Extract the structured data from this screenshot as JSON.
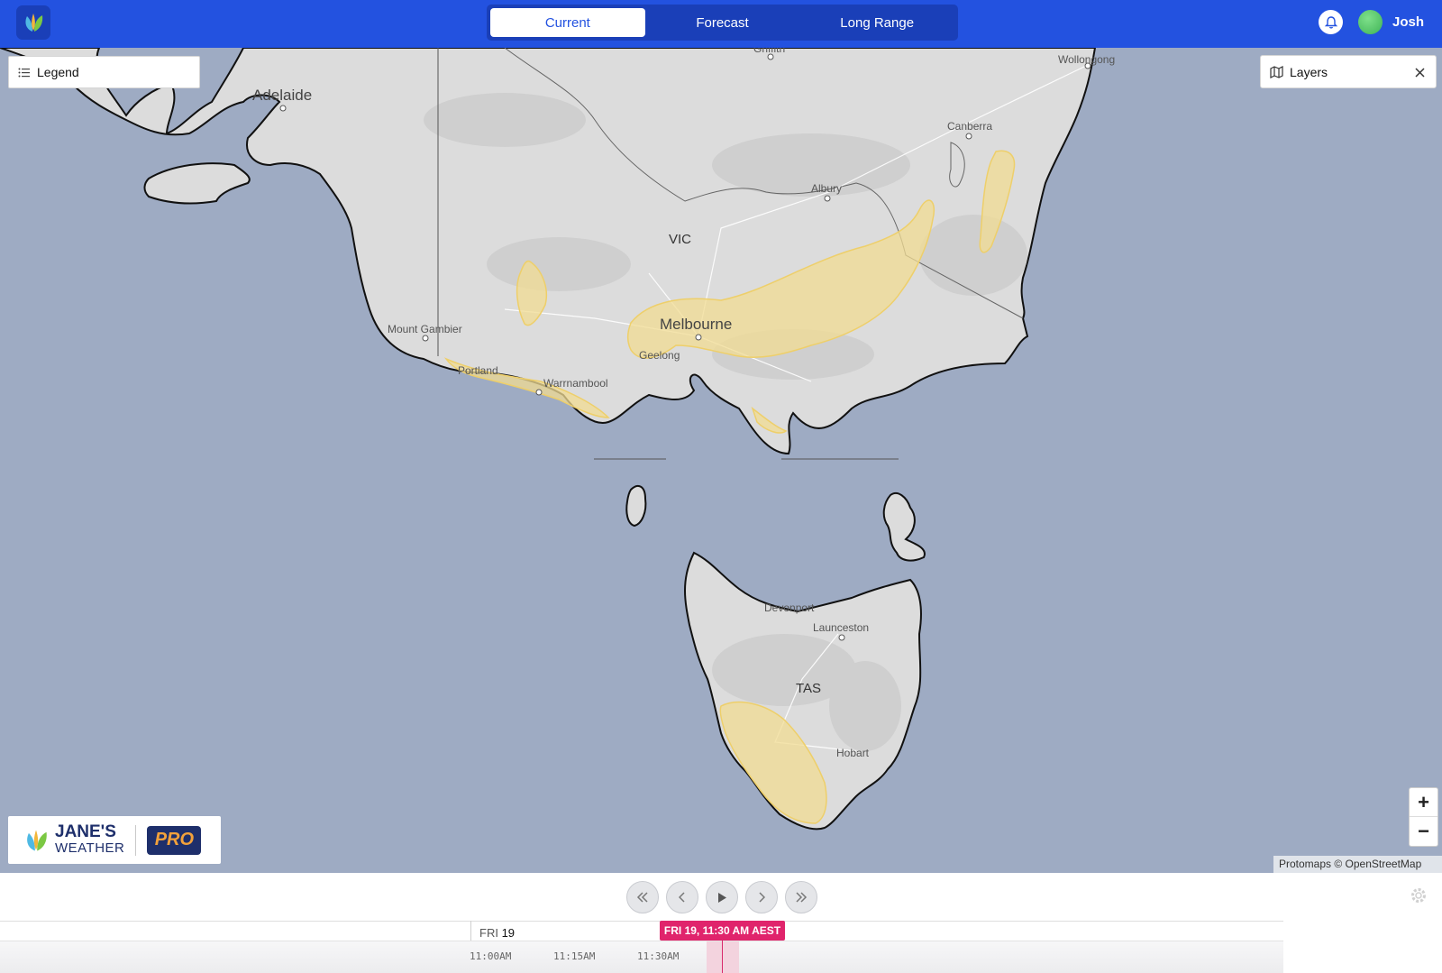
{
  "header": {
    "tabs": [
      {
        "label": "Current",
        "active": true
      },
      {
        "label": "Forecast",
        "active": false
      },
      {
        "label": "Long Range",
        "active": false
      }
    ],
    "user_name": "Josh",
    "accent_color": "#2352e0"
  },
  "map": {
    "legend_label": "Legend",
    "layers_label": "Layers",
    "place_labels": {
      "adelaide": "Adelaide",
      "griffith": "Griffith",
      "wollongong": "Wollongong",
      "canberra": "Canberra",
      "albury": "Albury",
      "vic": "VIC",
      "melbourne": "Melbourne",
      "mount_gambier": "Mount Gambier",
      "geelong": "Geelong",
      "portland": "Portland",
      "warrnambool": "Warrnambool",
      "devonport": "Devonport",
      "launceston": "Launceston",
      "tas": "TAS",
      "hobart": "Hobart"
    },
    "zoom_in": "+",
    "zoom_out": "−",
    "attribution": "Protomaps © OpenStreetMap",
    "warning_fill_color": "#f2dc93"
  },
  "brand": {
    "name": "JANE'S",
    "sub": "WEATHER",
    "badge": "PRO"
  },
  "timeline": {
    "day_label": "FRI",
    "day_number": "19",
    "current_time": "FRI 19, 11:30 AM AEST",
    "ticks": [
      "11:00AM",
      "11:15AM",
      "11:30AM"
    ],
    "controls": [
      "skip-back",
      "step-back",
      "play",
      "step-forward",
      "skip-forward"
    ]
  }
}
